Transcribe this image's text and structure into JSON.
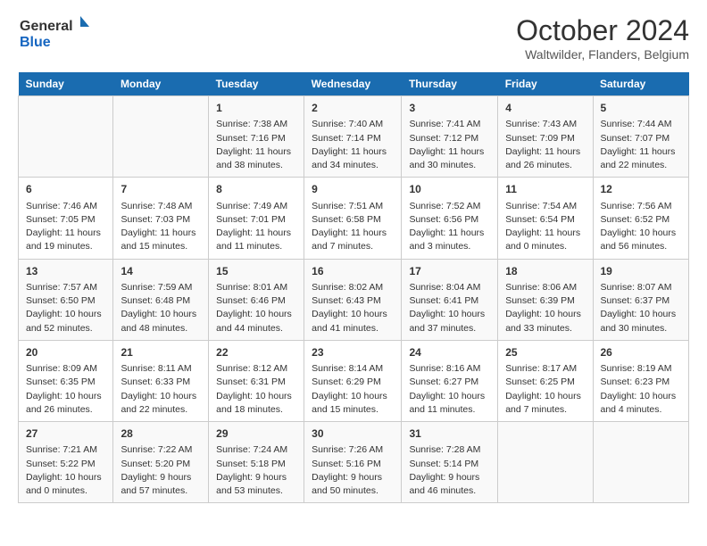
{
  "header": {
    "logo_general": "General",
    "logo_blue": "Blue",
    "title": "October 2024",
    "subtitle": "Waltwilder, Flanders, Belgium"
  },
  "days_of_week": [
    "Sunday",
    "Monday",
    "Tuesday",
    "Wednesday",
    "Thursday",
    "Friday",
    "Saturday"
  ],
  "weeks": [
    [
      {
        "day": "",
        "info": ""
      },
      {
        "day": "",
        "info": ""
      },
      {
        "day": "1",
        "info": "Sunrise: 7:38 AM\nSunset: 7:16 PM\nDaylight: 11 hours and 38 minutes."
      },
      {
        "day": "2",
        "info": "Sunrise: 7:40 AM\nSunset: 7:14 PM\nDaylight: 11 hours and 34 minutes."
      },
      {
        "day": "3",
        "info": "Sunrise: 7:41 AM\nSunset: 7:12 PM\nDaylight: 11 hours and 30 minutes."
      },
      {
        "day": "4",
        "info": "Sunrise: 7:43 AM\nSunset: 7:09 PM\nDaylight: 11 hours and 26 minutes."
      },
      {
        "day": "5",
        "info": "Sunrise: 7:44 AM\nSunset: 7:07 PM\nDaylight: 11 hours and 22 minutes."
      }
    ],
    [
      {
        "day": "6",
        "info": "Sunrise: 7:46 AM\nSunset: 7:05 PM\nDaylight: 11 hours and 19 minutes."
      },
      {
        "day": "7",
        "info": "Sunrise: 7:48 AM\nSunset: 7:03 PM\nDaylight: 11 hours and 15 minutes."
      },
      {
        "day": "8",
        "info": "Sunrise: 7:49 AM\nSunset: 7:01 PM\nDaylight: 11 hours and 11 minutes."
      },
      {
        "day": "9",
        "info": "Sunrise: 7:51 AM\nSunset: 6:58 PM\nDaylight: 11 hours and 7 minutes."
      },
      {
        "day": "10",
        "info": "Sunrise: 7:52 AM\nSunset: 6:56 PM\nDaylight: 11 hours and 3 minutes."
      },
      {
        "day": "11",
        "info": "Sunrise: 7:54 AM\nSunset: 6:54 PM\nDaylight: 11 hours and 0 minutes."
      },
      {
        "day": "12",
        "info": "Sunrise: 7:56 AM\nSunset: 6:52 PM\nDaylight: 10 hours and 56 minutes."
      }
    ],
    [
      {
        "day": "13",
        "info": "Sunrise: 7:57 AM\nSunset: 6:50 PM\nDaylight: 10 hours and 52 minutes."
      },
      {
        "day": "14",
        "info": "Sunrise: 7:59 AM\nSunset: 6:48 PM\nDaylight: 10 hours and 48 minutes."
      },
      {
        "day": "15",
        "info": "Sunrise: 8:01 AM\nSunset: 6:46 PM\nDaylight: 10 hours and 44 minutes."
      },
      {
        "day": "16",
        "info": "Sunrise: 8:02 AM\nSunset: 6:43 PM\nDaylight: 10 hours and 41 minutes."
      },
      {
        "day": "17",
        "info": "Sunrise: 8:04 AM\nSunset: 6:41 PM\nDaylight: 10 hours and 37 minutes."
      },
      {
        "day": "18",
        "info": "Sunrise: 8:06 AM\nSunset: 6:39 PM\nDaylight: 10 hours and 33 minutes."
      },
      {
        "day": "19",
        "info": "Sunrise: 8:07 AM\nSunset: 6:37 PM\nDaylight: 10 hours and 30 minutes."
      }
    ],
    [
      {
        "day": "20",
        "info": "Sunrise: 8:09 AM\nSunset: 6:35 PM\nDaylight: 10 hours and 26 minutes."
      },
      {
        "day": "21",
        "info": "Sunrise: 8:11 AM\nSunset: 6:33 PM\nDaylight: 10 hours and 22 minutes."
      },
      {
        "day": "22",
        "info": "Sunrise: 8:12 AM\nSunset: 6:31 PM\nDaylight: 10 hours and 18 minutes."
      },
      {
        "day": "23",
        "info": "Sunrise: 8:14 AM\nSunset: 6:29 PM\nDaylight: 10 hours and 15 minutes."
      },
      {
        "day": "24",
        "info": "Sunrise: 8:16 AM\nSunset: 6:27 PM\nDaylight: 10 hours and 11 minutes."
      },
      {
        "day": "25",
        "info": "Sunrise: 8:17 AM\nSunset: 6:25 PM\nDaylight: 10 hours and 7 minutes."
      },
      {
        "day": "26",
        "info": "Sunrise: 8:19 AM\nSunset: 6:23 PM\nDaylight: 10 hours and 4 minutes."
      }
    ],
    [
      {
        "day": "27",
        "info": "Sunrise: 7:21 AM\nSunset: 5:22 PM\nDaylight: 10 hours and 0 minutes."
      },
      {
        "day": "28",
        "info": "Sunrise: 7:22 AM\nSunset: 5:20 PM\nDaylight: 9 hours and 57 minutes."
      },
      {
        "day": "29",
        "info": "Sunrise: 7:24 AM\nSunset: 5:18 PM\nDaylight: 9 hours and 53 minutes."
      },
      {
        "day": "30",
        "info": "Sunrise: 7:26 AM\nSunset: 5:16 PM\nDaylight: 9 hours and 50 minutes."
      },
      {
        "day": "31",
        "info": "Sunrise: 7:28 AM\nSunset: 5:14 PM\nDaylight: 9 hours and 46 minutes."
      },
      {
        "day": "",
        "info": ""
      },
      {
        "day": "",
        "info": ""
      }
    ]
  ]
}
